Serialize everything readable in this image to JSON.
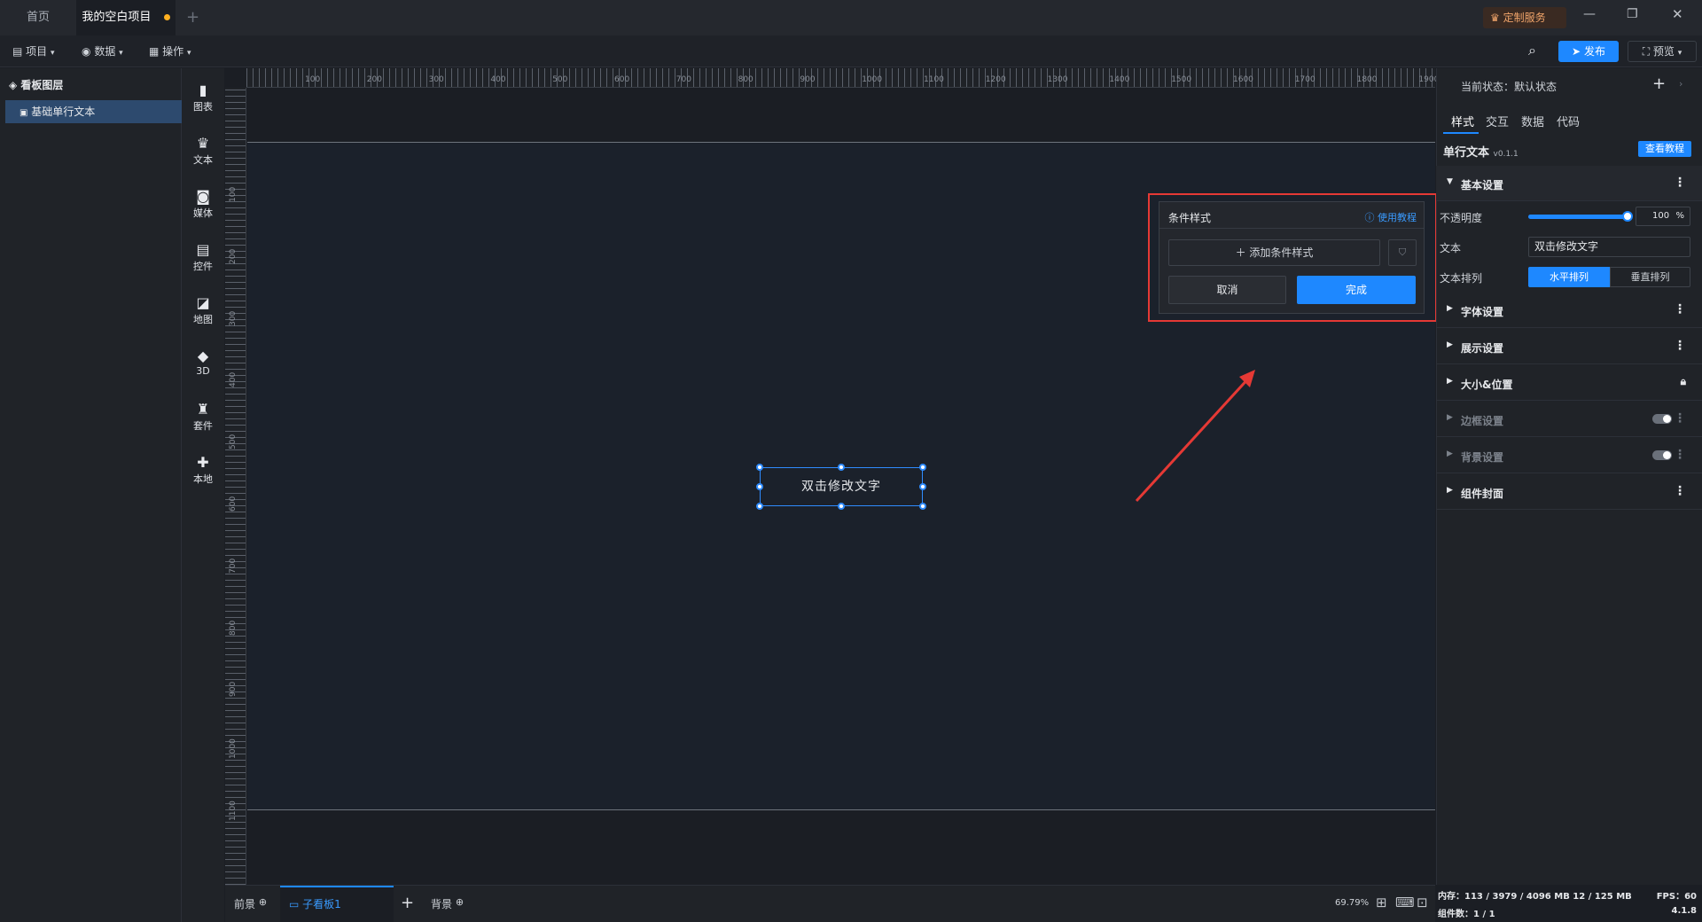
{
  "titlebar": {
    "tab_home": "首页",
    "tab_project": "我的空白项目",
    "custom_service": "定制服务"
  },
  "toolbar": {
    "project": "项目",
    "data": "数据",
    "operate": "操作",
    "publish": "发布",
    "preview": "预览"
  },
  "layers": {
    "title": "看板图层",
    "item": "基础单行文本"
  },
  "categories": [
    "图表",
    "文本",
    "媒体",
    "控件",
    "地图",
    "3D",
    "套件",
    "本地"
  ],
  "ruler": {
    "top": [
      "100",
      "200",
      "300",
      "400",
      "500",
      "600",
      "700",
      "800",
      "900",
      "1000",
      "1100",
      "1200",
      "1300",
      "1400",
      "1500",
      "1600",
      "1700",
      "1800",
      "1900"
    ],
    "left": [
      "100",
      "200",
      "300",
      "400",
      "500",
      "600",
      "700",
      "800",
      "900",
      "1000",
      "1100"
    ]
  },
  "canvas": {
    "text": "双击修改文字"
  },
  "popup": {
    "title": "条件样式",
    "tutorial": "使用教程",
    "add": "添加条件样式",
    "cancel": "取消",
    "done": "完成"
  },
  "right": {
    "state_label": "当前状态：默认状态",
    "tabs": [
      "样式",
      "交互",
      "数据",
      "代码"
    ],
    "component": "单行文本",
    "version": "v0.1.1",
    "view_tutorial": "查看教程",
    "basic": "基本设置",
    "opacity_label": "不透明度",
    "opacity_value": "100",
    "opacity_unit": "%",
    "opacity_fraction": 1.0,
    "text_label": "文本",
    "text_value": "双击修改文字",
    "arrange_label": "文本排列",
    "arrange_h": "水平排列",
    "arrange_v": "垂直排列",
    "sections": [
      "字体设置",
      "展示设置",
      "大小&位置",
      "边框设置",
      "背景设置",
      "组件封面"
    ]
  },
  "bottom": {
    "foreground": "前景",
    "subboard": "子看板1",
    "background": "背景",
    "zoom": "69.79%"
  },
  "status": {
    "memory": "内存：113 / 3979 / 4096 MB  12 / 125 MB",
    "fps": "FPS：60",
    "components": "组件数：1 / 1",
    "version": "4.1.8"
  },
  "colors": {
    "accent": "#1e88ff",
    "highlight_box": "#e53935",
    "arrow": "#e53935"
  }
}
